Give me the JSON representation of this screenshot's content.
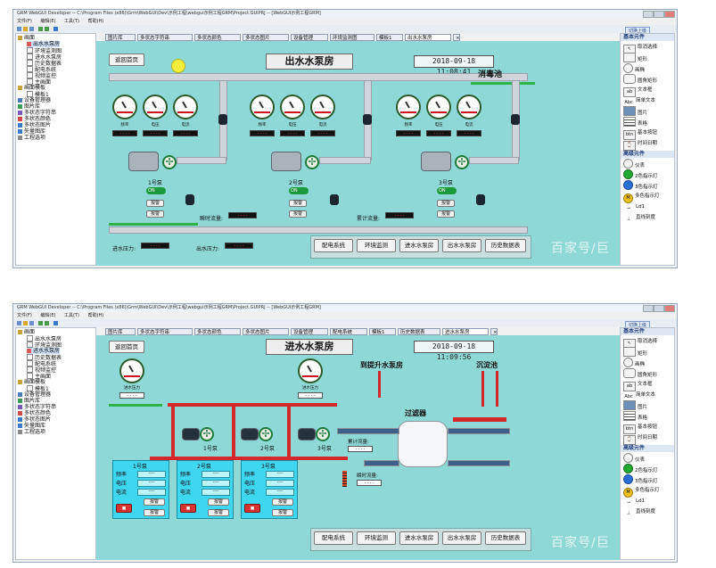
{
  "screens": [
    {
      "title_bar": "GRM WebGUI Developer -- C:\\Program Files (x86)\\Grm\\WebGUI\\Dev\\示例工程\\webgui示例工程GRM\\Project.GUIPRJ -- [WebGUI示例工程GRM]",
      "menu": [
        "文件(F)",
        "编辑(E)",
        "工具(T)",
        "帮助(H)"
      ],
      "tree": [
        "画面",
        "出水水泵房",
        "环境监测图",
        "进水水泵房",
        "历史数据表",
        "配电系统",
        "视频监控",
        "主画面",
        "画面模板",
        "模板1",
        "设备管理器",
        "图片库",
        "多状态字符串",
        "多状态颜色",
        "多状态图片",
        "矢量图库",
        "工程选项"
      ],
      "tabs": [
        "图片库",
        "多状态字符串",
        "多状态颜色",
        "多状态图片",
        "设备管理",
        "环境监测图",
        "模板1",
        "出水水泵房"
      ],
      "page_title": "出水水泵房",
      "clock": "2018-09-18 11:08:41",
      "back_button": "返回首页",
      "pool_label": "消毒池",
      "gauge_labels": [
        "频率",
        "电压",
        "电流"
      ],
      "pumps": [
        "1号泵",
        "2号泵",
        "3号泵"
      ],
      "toggle": "ON",
      "btn_a": "报警",
      "btn_b": "报警",
      "instant_flow": "瞬时流量:",
      "total_flow": "累计流量:",
      "inlet_pressure": "进水压力:",
      "outlet_pressure": "出水压力:",
      "nav": [
        "配电系统",
        "环境监测",
        "进水水泵房",
        "出水水泵房",
        "历史数据表"
      ]
    },
    {
      "title_bar": "GRM WebGUI Developer -- C:\\Program Files (x86)\\Grm\\WebGUI\\Dev\\示例工程\\webgui示例工程GRM\\Project.GUIPRJ -- [WebGUI示例工程GRM]",
      "menu": [
        "文件(F)",
        "编辑(E)",
        "工具(T)",
        "帮助(H)"
      ],
      "tree": [
        "画面",
        "出水水泵房",
        "环境监测图",
        "进水水泵房",
        "历史数据表",
        "配电系统",
        "视频监控",
        "主画面",
        "画面模板",
        "模板1",
        "设备管理器",
        "图片库",
        "多状态字符串",
        "多状态颜色",
        "多状态图片",
        "矢量图库",
        "工程选项"
      ],
      "tabs": [
        "图片库",
        "多状态字符串",
        "多状态颜色",
        "多状态图片",
        "设备管理",
        "配电系统",
        "模板1",
        "历史数据表",
        "进水水泵房"
      ],
      "page_title": "进水水泵房",
      "clock": "2018-09-18 11:09:56",
      "back_button": "返回首页",
      "to_lift": "到提升水泵房",
      "sediment": "沉淀池",
      "filter": "过滤器",
      "gauge_label": "进水压力",
      "pumps": [
        "1号泵",
        "2号泵",
        "3号泵"
      ],
      "panel_rows": [
        "频率",
        "电压",
        "电流"
      ],
      "total_flow": "累计流量:",
      "instant_flow": "瞬时流量:",
      "btn_a": "报警",
      "btn_b": "报警",
      "nav": [
        "配电系统",
        "环境监测",
        "进水水泵房",
        "出水水泵房",
        "历史数据表"
      ]
    }
  ],
  "palette": {
    "title": "基本元件",
    "items": [
      "取消选择",
      "矩形",
      "画椭",
      "圆角矩形",
      "文本框",
      "简单文本",
      "图片",
      "表格",
      "基本按钮",
      "时间日期"
    ],
    "advanced_title": "高级元件",
    "advanced_items": [
      "仪表",
      "2色指示灯",
      "3色指示灯",
      "多色指示灯",
      "Ld1",
      "直线刻度"
    ]
  },
  "top_right_button": "切换上级",
  "watermark": "百家号/巨",
  "colors": {
    "canvas": "#8fd8d8",
    "pipe": "#c9ced3",
    "red_pipe": "#d5272b",
    "panel_cyan": "#3fd7f0",
    "green": "#1c9a3a"
  }
}
